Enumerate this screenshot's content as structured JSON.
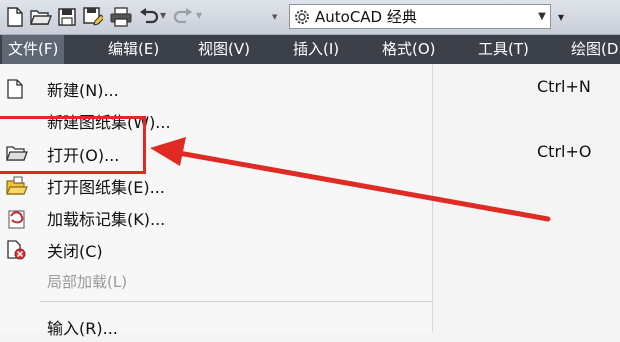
{
  "toolbar": {
    "workspace_value": "AutoCAD 经典",
    "icons": [
      "new-file-icon",
      "open-folder-icon",
      "save-icon",
      "save-as-icon",
      "print-icon",
      "undo-icon",
      "redo-icon",
      "gear-icon"
    ]
  },
  "menubar": {
    "items": [
      {
        "label": "文件(F)",
        "active": true
      },
      {
        "label": "编辑(E)"
      },
      {
        "label": "视图(V)"
      },
      {
        "label": "插入(I)"
      },
      {
        "label": "格式(O)"
      },
      {
        "label": "工具(T)"
      },
      {
        "label": "绘图(D"
      }
    ]
  },
  "file_menu": {
    "items": [
      {
        "label": "新建(N)...",
        "shortcut": "Ctrl+N",
        "icon": "new-file-icon"
      },
      {
        "label": "新建图纸集(W)...",
        "shortcut": "",
        "icon": ""
      },
      {
        "label": "打开(O)...",
        "shortcut": "Ctrl+O",
        "icon": "open-folder-icon"
      },
      {
        "label": "打开图纸集(E)...",
        "shortcut": "",
        "icon": "open-sheet-set-icon"
      },
      {
        "label": "加载标记集(K)...",
        "shortcut": "",
        "icon": "markup-set-icon"
      },
      {
        "label": "关闭(C)",
        "shortcut": "",
        "icon": "close-drawing-icon"
      },
      {
        "label": "局部加载(L)",
        "shortcut": "",
        "icon": "",
        "disabled": true
      },
      {
        "label": "输入(R)...",
        "shortcut": "",
        "icon": ""
      }
    ]
  },
  "colors": {
    "menubar_bg": "#3c4149",
    "menubar_active": "#606774",
    "annotation_red": "#e02a24"
  }
}
